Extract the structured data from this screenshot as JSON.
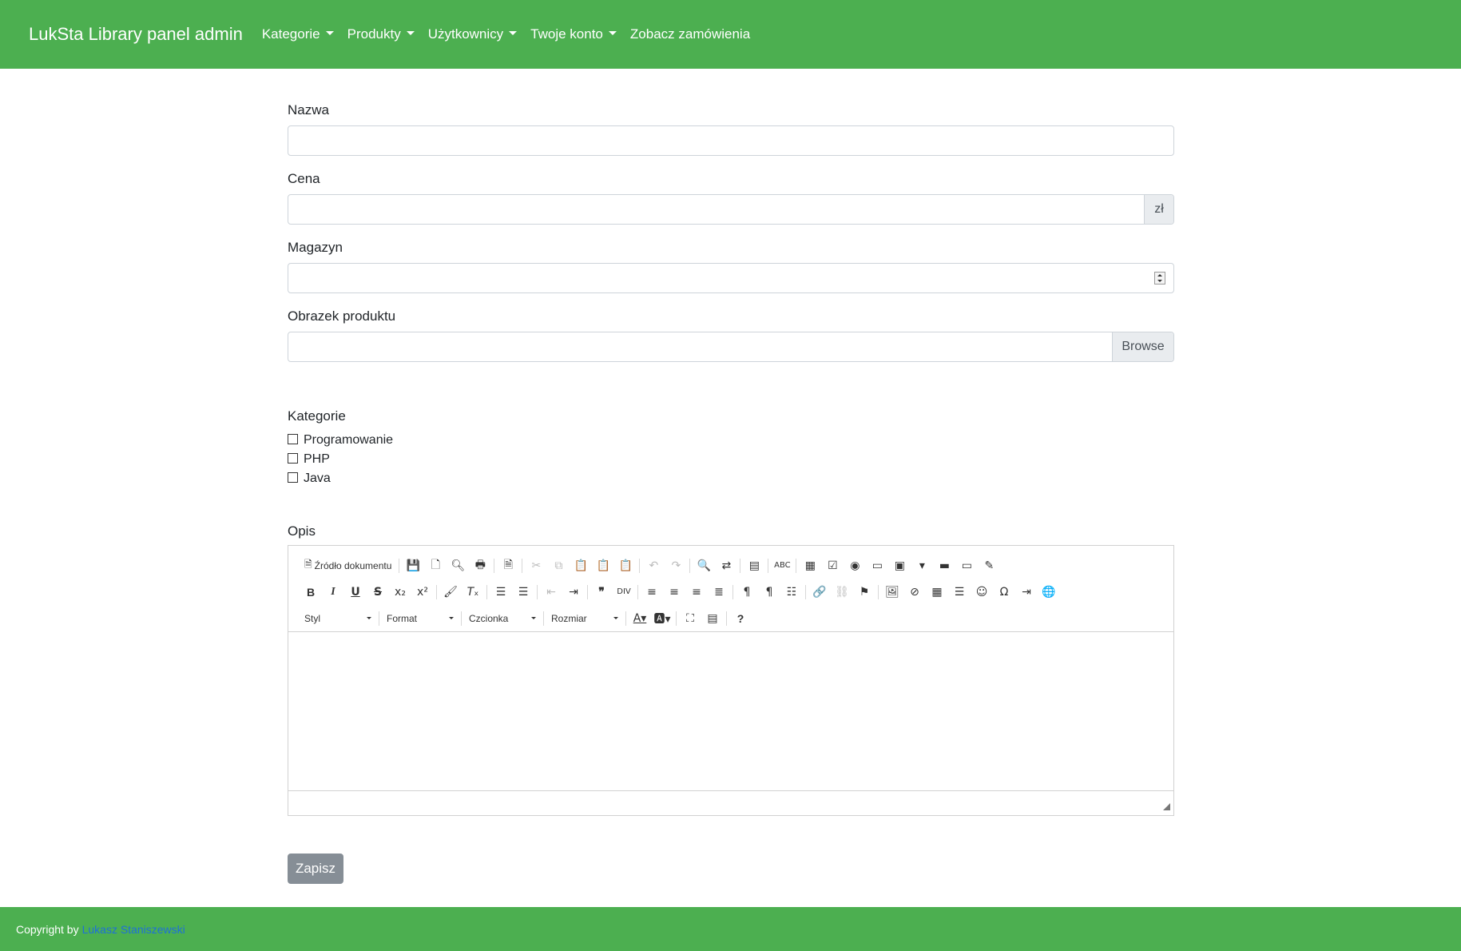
{
  "navbar": {
    "brand": "LukSta Library panel admin",
    "items": [
      {
        "label": "Kategorie",
        "dropdown": true
      },
      {
        "label": "Produkty",
        "dropdown": true
      },
      {
        "label": "Użytkownicy",
        "dropdown": true
      },
      {
        "label": "Twoje konto",
        "dropdown": true
      },
      {
        "label": "Zobacz zamówienia",
        "dropdown": false
      }
    ],
    "color": "#4caf50"
  },
  "form": {
    "name": {
      "label": "Nazwa",
      "value": ""
    },
    "price": {
      "label": "Cena",
      "value": "",
      "addon": "zł"
    },
    "stock": {
      "label": "Magazyn",
      "value": ""
    },
    "image": {
      "label": "Obrazek produktu",
      "value": "",
      "button": "Browse"
    },
    "categories": {
      "label": "Kategorie",
      "options": [
        {
          "label": "Programowanie",
          "checked": false
        },
        {
          "label": "PHP",
          "checked": false
        },
        {
          "label": "Java",
          "checked": false
        }
      ]
    },
    "description": {
      "label": "Opis",
      "toolbar": {
        "source_label": "Źródło dokumentu",
        "style_combo": "Styl",
        "format_combo": "Format",
        "font_combo": "Czcionka",
        "size_combo": "Rozmiar"
      },
      "value": ""
    },
    "submit_label": "Zapisz"
  },
  "footer": {
    "text": "Copyright by",
    "author_link": "Lukasz Staniszewski"
  }
}
